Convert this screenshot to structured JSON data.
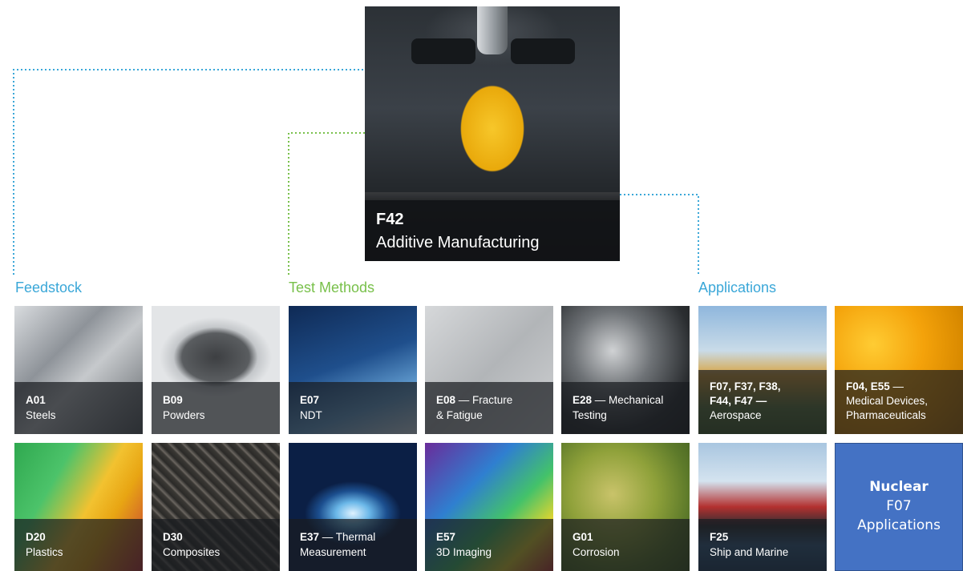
{
  "hero": {
    "code": "F42",
    "name": "Additive Manufacturing"
  },
  "categories": {
    "feedstock": {
      "label": "Feedstock",
      "color": "#3aa7d8"
    },
    "test_methods": {
      "label": "Test Methods",
      "color": "#78c04a"
    },
    "applications": {
      "label": "Applications",
      "color": "#3aa7d8"
    }
  },
  "row1": [
    {
      "code": "A01",
      "line1_rest": "",
      "line2": "Steels",
      "line3": "",
      "icon": "steel-beams"
    },
    {
      "code": "B09",
      "line1_rest": "",
      "line2": "Powders",
      "line3": "",
      "icon": "metal-powder"
    },
    {
      "code": "E07",
      "line1_rest": "",
      "line2": "NDT",
      "line3": "",
      "icon": "space-shuttle"
    },
    {
      "code": "E08",
      "line1_rest": " — Fracture",
      "line2": "& Fatigue",
      "line3": "",
      "icon": "cracked-surface"
    },
    {
      "code": "E28",
      "line1_rest": " — Mechanical",
      "line2": "Testing",
      "line3": "",
      "icon": "gears"
    },
    {
      "code": "F07, F37, F38,",
      "line1_rest": "",
      "line2": "F44, F47 —",
      "line3": "Aerospace",
      "icon": "propeller-aircraft"
    },
    {
      "code": "F04, E55",
      "line1_rest": " —",
      "line2": "Medical Devices,",
      "line3": "Pharmaceuticals",
      "icon": "pills"
    }
  ],
  "row2": [
    {
      "code": "D20",
      "line1_rest": "",
      "line2": "Plastics",
      "icon": "plastic-rolls"
    },
    {
      "code": "D30",
      "line1_rest": "",
      "line2": "Composites",
      "icon": "carbon-fiber"
    },
    {
      "code": "E37",
      "line1_rest": " — Thermal",
      "line2": "Measurement",
      "icon": "thermal-turbine"
    },
    {
      "code": "E57",
      "line1_rest": "",
      "line2": "3D Imaging",
      "icon": "3d-scan"
    },
    {
      "code": "G01",
      "line1_rest": "",
      "line2": "Corrosion",
      "icon": "corrosion-texture"
    },
    {
      "code": "F25",
      "line1_rest": "",
      "line2": "Ship and Marine",
      "icon": "cargo-ship"
    }
  ],
  "nuclear": {
    "title": "Nuclear",
    "code": "F07",
    "label": "Applications",
    "color": "#4472c4"
  }
}
